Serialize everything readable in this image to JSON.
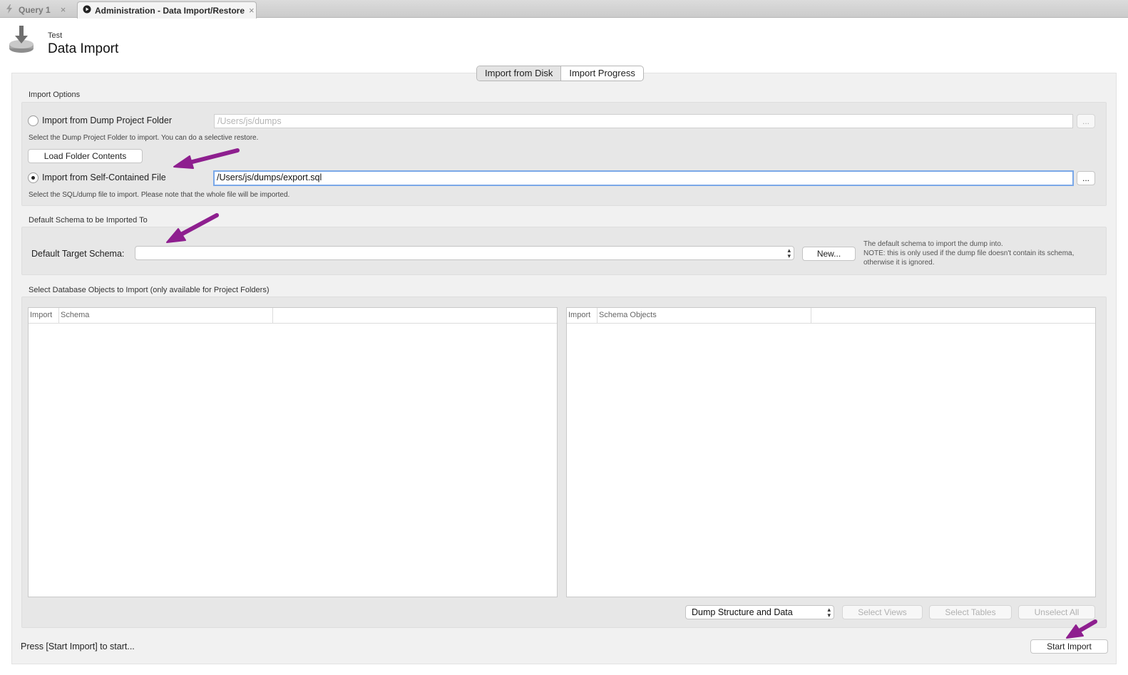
{
  "tabs": [
    {
      "label": "Query 1",
      "close": "×",
      "icon": "lightning-icon"
    },
    {
      "label": "Administration - Data Import/Restore",
      "close": "×",
      "icon": "play-circle-icon"
    }
  ],
  "header": {
    "subtitle": "Test",
    "title": "Data Import",
    "icon": "data-import-icon"
  },
  "segmented": {
    "options": [
      "Import from Disk",
      "Import Progress"
    ],
    "selected": "Import from Disk"
  },
  "import_options": {
    "group_label": "Import Options",
    "dump_folder": {
      "label": "Import from Dump Project Folder",
      "path": "/Users/js/dumps",
      "browse": "...",
      "hint": "Select the Dump Project Folder to import. You can do a selective restore.",
      "selected": false
    },
    "load_folder_button": "Load Folder Contents",
    "self_contained": {
      "label": "Import from Self-Contained File",
      "path": "/Users/js/dumps/export.sql",
      "browse": "...",
      "hint": "Select the SQL/dump file to import. Please note that the whole file will be imported.",
      "selected": true
    }
  },
  "default_schema": {
    "group_label": "Default Schema to be Imported To",
    "field_label": "Default Target Schema:",
    "value": "",
    "new_button": "New...",
    "note_line1": "The default schema to import the dump into.",
    "note_line2": "NOTE: this is only used if the dump file doesn't contain its schema,",
    "note_line3": "otherwise it is ignored."
  },
  "objects": {
    "group_label": "Select Database Objects to Import (only available for Project Folders)",
    "left_table": {
      "columns": [
        "Import",
        "Schema"
      ]
    },
    "right_table": {
      "columns": [
        "Import",
        "Schema Objects"
      ]
    },
    "dump_select": "Dump Structure and Data",
    "select_views": "Select Views",
    "select_tables": "Select Tables",
    "unselect_all": "Unselect All"
  },
  "status_text": "Press [Start Import] to start...",
  "start_button": "Start Import",
  "colors": {
    "accent_arrow": "#8e1f8f",
    "focus_ring": "#7aa8e8",
    "panel_bg": "#f1f1f1",
    "group_bg": "#e7e7e7"
  }
}
